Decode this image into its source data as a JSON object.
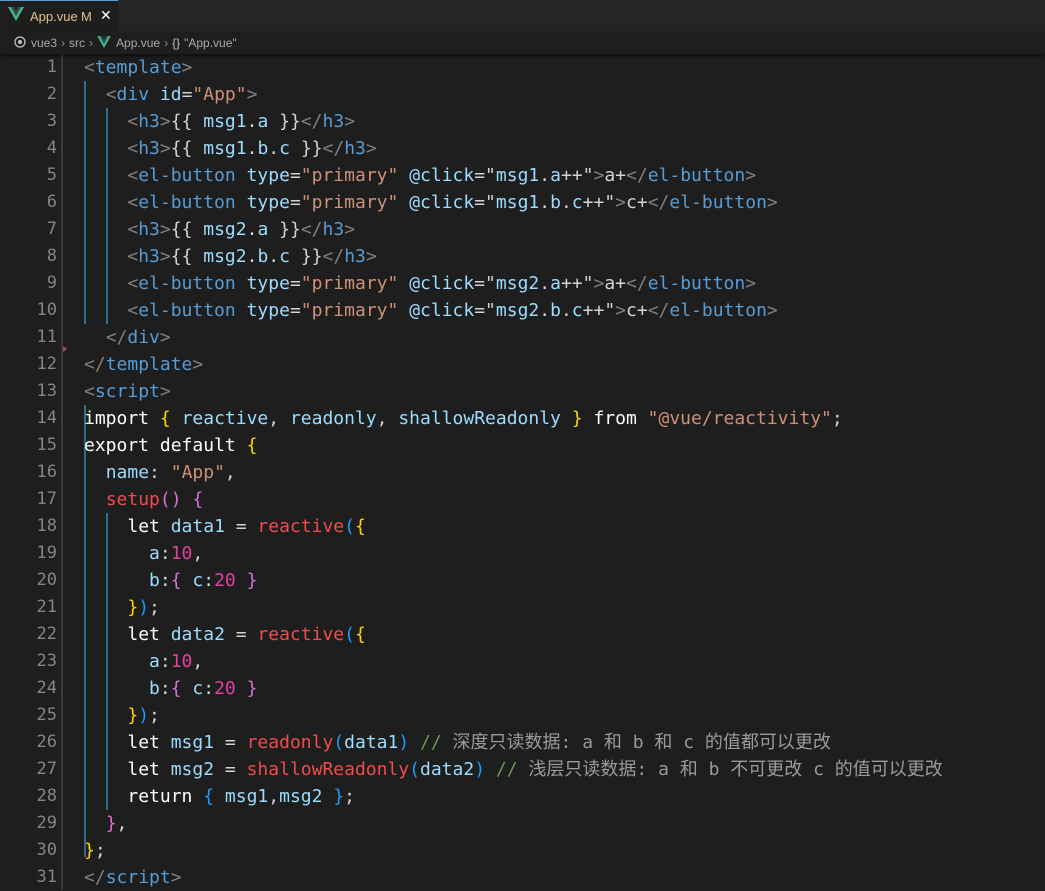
{
  "tab": {
    "filename": "App.vue",
    "modified_badge": "M",
    "close_glyph": "✕",
    "icon": "vue-icon"
  },
  "breadcrumb": {
    "folder": "vue3",
    "subfolder": "src",
    "file": "App.vue",
    "symbol_icon": "{}",
    "symbol": "\"App.vue\""
  },
  "colors": {
    "background": "#1e1e1e",
    "tabbar": "#252526",
    "line_numbers": "#858585",
    "tag_name": "#569cd6",
    "attribute": "#9cdcfe",
    "string": "#ce9178",
    "bracket_level1": "#ffd700",
    "bracket_level2": "#da70d6",
    "bracket_level3": "#179fff",
    "number": "#e040a0",
    "function": "#f14c4c",
    "indent_guide_active": "#2f6d8c",
    "vue_logo": "#41b883"
  },
  "lines": [
    {
      "number": "1",
      "tokens": [
        [
          "tg",
          "<"
        ],
        [
          "tn",
          "template"
        ],
        [
          "tg",
          ">"
        ]
      ]
    },
    {
      "number": "2",
      "tokens": [
        [
          "tx",
          "  "
        ],
        [
          "tg",
          "<"
        ],
        [
          "tn",
          "div"
        ],
        [
          "tx",
          " "
        ],
        [
          "at",
          "id"
        ],
        [
          "tx",
          "="
        ],
        [
          "st",
          "\"App\""
        ],
        [
          "tg",
          ">"
        ]
      ]
    },
    {
      "number": "3",
      "tokens": [
        [
          "tx",
          "    "
        ],
        [
          "tg",
          "<"
        ],
        [
          "tn",
          "h3"
        ],
        [
          "tg",
          ">"
        ],
        [
          "tx",
          "{{ "
        ],
        [
          "vr",
          "msg1"
        ],
        [
          "tx",
          "."
        ],
        [
          "vr",
          "a"
        ],
        [
          "tx",
          " }}"
        ],
        [
          "tg",
          "</"
        ],
        [
          "tn",
          "h3"
        ],
        [
          "tg",
          ">"
        ]
      ]
    },
    {
      "number": "4",
      "tokens": [
        [
          "tx",
          "    "
        ],
        [
          "tg",
          "<"
        ],
        [
          "tn",
          "h3"
        ],
        [
          "tg",
          ">"
        ],
        [
          "tx",
          "{{ "
        ],
        [
          "vr",
          "msg1"
        ],
        [
          "tx",
          "."
        ],
        [
          "vr",
          "b"
        ],
        [
          "tx",
          "."
        ],
        [
          "vr",
          "c"
        ],
        [
          "tx",
          " }}"
        ],
        [
          "tg",
          "</"
        ],
        [
          "tn",
          "h3"
        ],
        [
          "tg",
          ">"
        ]
      ]
    },
    {
      "number": "5",
      "tokens": [
        [
          "tx",
          "    "
        ],
        [
          "tg",
          "<"
        ],
        [
          "tn",
          "el-button"
        ],
        [
          "tx",
          " "
        ],
        [
          "at",
          "type"
        ],
        [
          "tx",
          "="
        ],
        [
          "st",
          "\"primary\""
        ],
        [
          "tx",
          " "
        ],
        [
          "at",
          "@click"
        ],
        [
          "tx",
          "=\""
        ],
        [
          "vr",
          "msg1"
        ],
        [
          "tx",
          "."
        ],
        [
          "vr",
          "a"
        ],
        [
          "tx",
          "++\""
        ],
        [
          "tg",
          ">"
        ],
        [
          "tx",
          "a+"
        ],
        [
          "tg",
          "</"
        ],
        [
          "tn",
          "el-button"
        ],
        [
          "tg",
          ">"
        ]
      ]
    },
    {
      "number": "6",
      "tokens": [
        [
          "tx",
          "    "
        ],
        [
          "tg",
          "<"
        ],
        [
          "tn",
          "el-button"
        ],
        [
          "tx",
          " "
        ],
        [
          "at",
          "type"
        ],
        [
          "tx",
          "="
        ],
        [
          "st",
          "\"primary\""
        ],
        [
          "tx",
          " "
        ],
        [
          "at",
          "@click"
        ],
        [
          "tx",
          "=\""
        ],
        [
          "vr",
          "msg1"
        ],
        [
          "tx",
          "."
        ],
        [
          "vr",
          "b"
        ],
        [
          "tx",
          "."
        ],
        [
          "vr",
          "c"
        ],
        [
          "tx",
          "++\""
        ],
        [
          "tg",
          ">"
        ],
        [
          "tx",
          "c+"
        ],
        [
          "tg",
          "</"
        ],
        [
          "tn",
          "el-button"
        ],
        [
          "tg",
          ">"
        ]
      ]
    },
    {
      "number": "7",
      "tokens": [
        [
          "tx",
          "    "
        ],
        [
          "tg",
          "<"
        ],
        [
          "tn",
          "h3"
        ],
        [
          "tg",
          ">"
        ],
        [
          "tx",
          "{{ "
        ],
        [
          "vr",
          "msg2"
        ],
        [
          "tx",
          "."
        ],
        [
          "vr",
          "a"
        ],
        [
          "tx",
          " }}"
        ],
        [
          "tg",
          "</"
        ],
        [
          "tn",
          "h3"
        ],
        [
          "tg",
          ">"
        ]
      ]
    },
    {
      "number": "8",
      "tokens": [
        [
          "tx",
          "    "
        ],
        [
          "tg",
          "<"
        ],
        [
          "tn",
          "h3"
        ],
        [
          "tg",
          ">"
        ],
        [
          "tx",
          "{{ "
        ],
        [
          "vr",
          "msg2"
        ],
        [
          "tx",
          "."
        ],
        [
          "vr",
          "b"
        ],
        [
          "tx",
          "."
        ],
        [
          "vr",
          "c"
        ],
        [
          "tx",
          " }}"
        ],
        [
          "tg",
          "</"
        ],
        [
          "tn",
          "h3"
        ],
        [
          "tg",
          ">"
        ]
      ]
    },
    {
      "number": "9",
      "tokens": [
        [
          "tx",
          "    "
        ],
        [
          "tg",
          "<"
        ],
        [
          "tn",
          "el-button"
        ],
        [
          "tx",
          " "
        ],
        [
          "at",
          "type"
        ],
        [
          "tx",
          "="
        ],
        [
          "st",
          "\"primary\""
        ],
        [
          "tx",
          " "
        ],
        [
          "at",
          "@click"
        ],
        [
          "tx",
          "=\""
        ],
        [
          "vr",
          "msg2"
        ],
        [
          "tx",
          "."
        ],
        [
          "vr",
          "a"
        ],
        [
          "tx",
          "++\""
        ],
        [
          "tg",
          ">"
        ],
        [
          "tx",
          "a+"
        ],
        [
          "tg",
          "</"
        ],
        [
          "tn",
          "el-button"
        ],
        [
          "tg",
          ">"
        ]
      ]
    },
    {
      "number": "10",
      "tokens": [
        [
          "tx",
          "    "
        ],
        [
          "tg",
          "<"
        ],
        [
          "tn",
          "el-button"
        ],
        [
          "tx",
          " "
        ],
        [
          "at",
          "type"
        ],
        [
          "tx",
          "="
        ],
        [
          "st",
          "\"primary\""
        ],
        [
          "tx",
          " "
        ],
        [
          "at",
          "@click"
        ],
        [
          "tx",
          "=\""
        ],
        [
          "vr",
          "msg2"
        ],
        [
          "tx",
          "."
        ],
        [
          "vr",
          "b"
        ],
        [
          "tx",
          "."
        ],
        [
          "vr",
          "c"
        ],
        [
          "tx",
          "++\""
        ],
        [
          "tg",
          ">"
        ],
        [
          "tx",
          "c+"
        ],
        [
          "tg",
          "</"
        ],
        [
          "tn",
          "el-button"
        ],
        [
          "tg",
          ">"
        ]
      ]
    },
    {
      "number": "11",
      "tokens": [
        [
          "tx",
          "  "
        ],
        [
          "tg",
          "</"
        ],
        [
          "tn",
          "div"
        ],
        [
          "tg",
          ">"
        ]
      ]
    },
    {
      "number": "12",
      "tokens": [
        [
          "tg",
          "</"
        ],
        [
          "tn",
          "template"
        ],
        [
          "tg",
          ">"
        ]
      ]
    },
    {
      "number": "13",
      "tokens": [
        [
          "tg",
          "<"
        ],
        [
          "tn",
          "script"
        ],
        [
          "tg",
          ">"
        ]
      ]
    },
    {
      "number": "14",
      "tokens": [
        [
          "kw",
          "import"
        ],
        [
          "tx",
          " "
        ],
        [
          "p1",
          "{"
        ],
        [
          "tx",
          " "
        ],
        [
          "vr",
          "reactive"
        ],
        [
          "tx",
          ", "
        ],
        [
          "vr",
          "readonly"
        ],
        [
          "tx",
          ", "
        ],
        [
          "vr",
          "shallowReadonly"
        ],
        [
          "tx",
          " "
        ],
        [
          "p1",
          "}"
        ],
        [
          "tx",
          " "
        ],
        [
          "kw",
          "from"
        ],
        [
          "tx",
          " "
        ],
        [
          "st",
          "\"@vue/reactivity\""
        ],
        [
          "tx",
          ";"
        ]
      ]
    },
    {
      "number": "15",
      "tokens": [
        [
          "kw",
          "export"
        ],
        [
          "tx",
          " "
        ],
        [
          "kw",
          "default"
        ],
        [
          "tx",
          " "
        ],
        [
          "p1",
          "{"
        ]
      ]
    },
    {
      "number": "16",
      "tokens": [
        [
          "tx",
          "  "
        ],
        [
          "vr",
          "name"
        ],
        [
          "tx",
          ": "
        ],
        [
          "st",
          "\"App\""
        ],
        [
          "tx",
          ","
        ]
      ]
    },
    {
      "number": "17",
      "tokens": [
        [
          "tx",
          "  "
        ],
        [
          "fn",
          "setup"
        ],
        [
          "p2",
          "()"
        ],
        [
          "tx",
          " "
        ],
        [
          "p2",
          "{"
        ]
      ]
    },
    {
      "number": "18",
      "tokens": [
        [
          "tx",
          "    "
        ],
        [
          "kw",
          "let"
        ],
        [
          "tx",
          " "
        ],
        [
          "vr",
          "data1"
        ],
        [
          "tx",
          " = "
        ],
        [
          "fn",
          "reactive"
        ],
        [
          "p3",
          "("
        ],
        [
          "p1",
          "{"
        ]
      ]
    },
    {
      "number": "19",
      "tokens": [
        [
          "tx",
          "      "
        ],
        [
          "vr",
          "a"
        ],
        [
          "tx",
          ":"
        ],
        [
          "nm",
          "10"
        ],
        [
          "tx",
          ","
        ]
      ]
    },
    {
      "number": "20",
      "tokens": [
        [
          "tx",
          "      "
        ],
        [
          "vr",
          "b"
        ],
        [
          "tx",
          ":"
        ],
        [
          "p2",
          "{"
        ],
        [
          "tx",
          " "
        ],
        [
          "vr",
          "c"
        ],
        [
          "tx",
          ":"
        ],
        [
          "nm",
          "20"
        ],
        [
          "tx",
          " "
        ],
        [
          "p2",
          "}"
        ]
      ]
    },
    {
      "number": "21",
      "tokens": [
        [
          "tx",
          "    "
        ],
        [
          "p1",
          "}"
        ],
        [
          "p3",
          ")"
        ],
        [
          "tx",
          ";"
        ]
      ]
    },
    {
      "number": "22",
      "tokens": [
        [
          "tx",
          "    "
        ],
        [
          "kw",
          "let"
        ],
        [
          "tx",
          " "
        ],
        [
          "vr",
          "data2"
        ],
        [
          "tx",
          " = "
        ],
        [
          "fn",
          "reactive"
        ],
        [
          "p3",
          "("
        ],
        [
          "p1",
          "{"
        ]
      ]
    },
    {
      "number": "23",
      "tokens": [
        [
          "tx",
          "      "
        ],
        [
          "vr",
          "a"
        ],
        [
          "tx",
          ":"
        ],
        [
          "nm",
          "10"
        ],
        [
          "tx",
          ","
        ]
      ]
    },
    {
      "number": "24",
      "tokens": [
        [
          "tx",
          "      "
        ],
        [
          "vr",
          "b"
        ],
        [
          "tx",
          ":"
        ],
        [
          "p2",
          "{"
        ],
        [
          "tx",
          " "
        ],
        [
          "vr",
          "c"
        ],
        [
          "tx",
          ":"
        ],
        [
          "nm",
          "20"
        ],
        [
          "tx",
          " "
        ],
        [
          "p2",
          "}"
        ]
      ]
    },
    {
      "number": "25",
      "tokens": [
        [
          "tx",
          "    "
        ],
        [
          "p1",
          "}"
        ],
        [
          "p3",
          ")"
        ],
        [
          "tx",
          ";"
        ]
      ]
    },
    {
      "number": "26",
      "tokens": [
        [
          "tx",
          "    "
        ],
        [
          "kw",
          "let"
        ],
        [
          "tx",
          " "
        ],
        [
          "vr",
          "msg1"
        ],
        [
          "tx",
          " = "
        ],
        [
          "fn",
          "readonly"
        ],
        [
          "p3",
          "("
        ],
        [
          "vr",
          "data1"
        ],
        [
          "p3",
          ")"
        ],
        [
          "tx",
          " "
        ],
        [
          "cm",
          "// "
        ],
        [
          "cg",
          "深度只读数据: a 和 b 和 c 的值都可以更改"
        ]
      ]
    },
    {
      "number": "27",
      "tokens": [
        [
          "tx",
          "    "
        ],
        [
          "kw",
          "let"
        ],
        [
          "tx",
          " "
        ],
        [
          "vr",
          "msg2"
        ],
        [
          "tx",
          " = "
        ],
        [
          "fn",
          "shallowReadonly"
        ],
        [
          "p3",
          "("
        ],
        [
          "vr",
          "data2"
        ],
        [
          "p3",
          ")"
        ],
        [
          "tx",
          " "
        ],
        [
          "cm",
          "// "
        ],
        [
          "cg",
          "浅层只读数据: a 和 b 不可更改 c 的值可以更改"
        ]
      ]
    },
    {
      "number": "28",
      "tokens": [
        [
          "tx",
          "    "
        ],
        [
          "kw",
          "return"
        ],
        [
          "tx",
          " "
        ],
        [
          "p3",
          "{"
        ],
        [
          "tx",
          " "
        ],
        [
          "vr",
          "msg1"
        ],
        [
          "tx",
          ","
        ],
        [
          "vr",
          "msg2"
        ],
        [
          "tx",
          " "
        ],
        [
          "p3",
          "}"
        ],
        [
          "tx",
          ";"
        ]
      ]
    },
    {
      "number": "29",
      "tokens": [
        [
          "tx",
          "  "
        ],
        [
          "p2",
          "}"
        ],
        [
          "tx",
          ","
        ]
      ]
    },
    {
      "number": "30",
      "tokens": [
        [
          "p1",
          "}"
        ],
        [
          "tx",
          ";"
        ]
      ]
    },
    {
      "number": "31",
      "tokens": [
        [
          "tg",
          "</"
        ],
        [
          "tn",
          "script"
        ],
        [
          "tg",
          ">"
        ]
      ]
    }
  ]
}
